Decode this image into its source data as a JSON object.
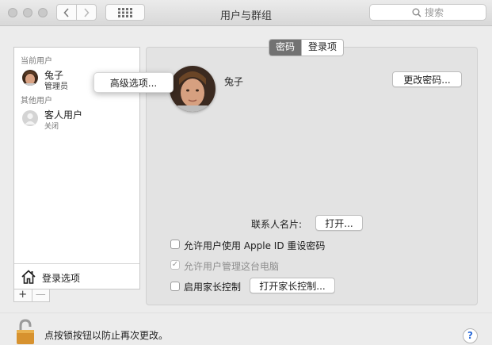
{
  "window": {
    "title": "用户与群组"
  },
  "search": {
    "placeholder": "搜索",
    "icon": "search-icon"
  },
  "sidebar": {
    "current_section": "当前用户",
    "current_user": {
      "name": "兔子",
      "role": "管理员"
    },
    "other_section": "其他用户",
    "guest_user": {
      "name": "客人用户",
      "status": "关闭"
    },
    "login_options_label": "登录选项",
    "add_symbol": "+",
    "remove_symbol": "—"
  },
  "context_menu": {
    "advanced_options": "高级选项..."
  },
  "tabs": [
    {
      "label": "密码",
      "active": true
    },
    {
      "label": "登录项",
      "active": false
    }
  ],
  "main": {
    "user_name": "兔子",
    "change_password": "更改密码...",
    "contact_card_label": "联系人名片:",
    "open_button": "打开...",
    "allow_apple_id": "允许用户使用 Apple ID 重设密码",
    "allow_admin": "允许用户管理这台电脑",
    "parental_controls": "启用家长控制",
    "open_parental_controls": "打开家长控制...",
    "allow_apple_id_checked": false,
    "allow_admin_checked": true,
    "parental_controls_checked": false
  },
  "footer": {
    "lock_text": "点按锁按钮以防止再次更改。",
    "help_symbol": "?"
  },
  "colors": {
    "tab_active": "#727272",
    "help": "#2a6ad8"
  }
}
